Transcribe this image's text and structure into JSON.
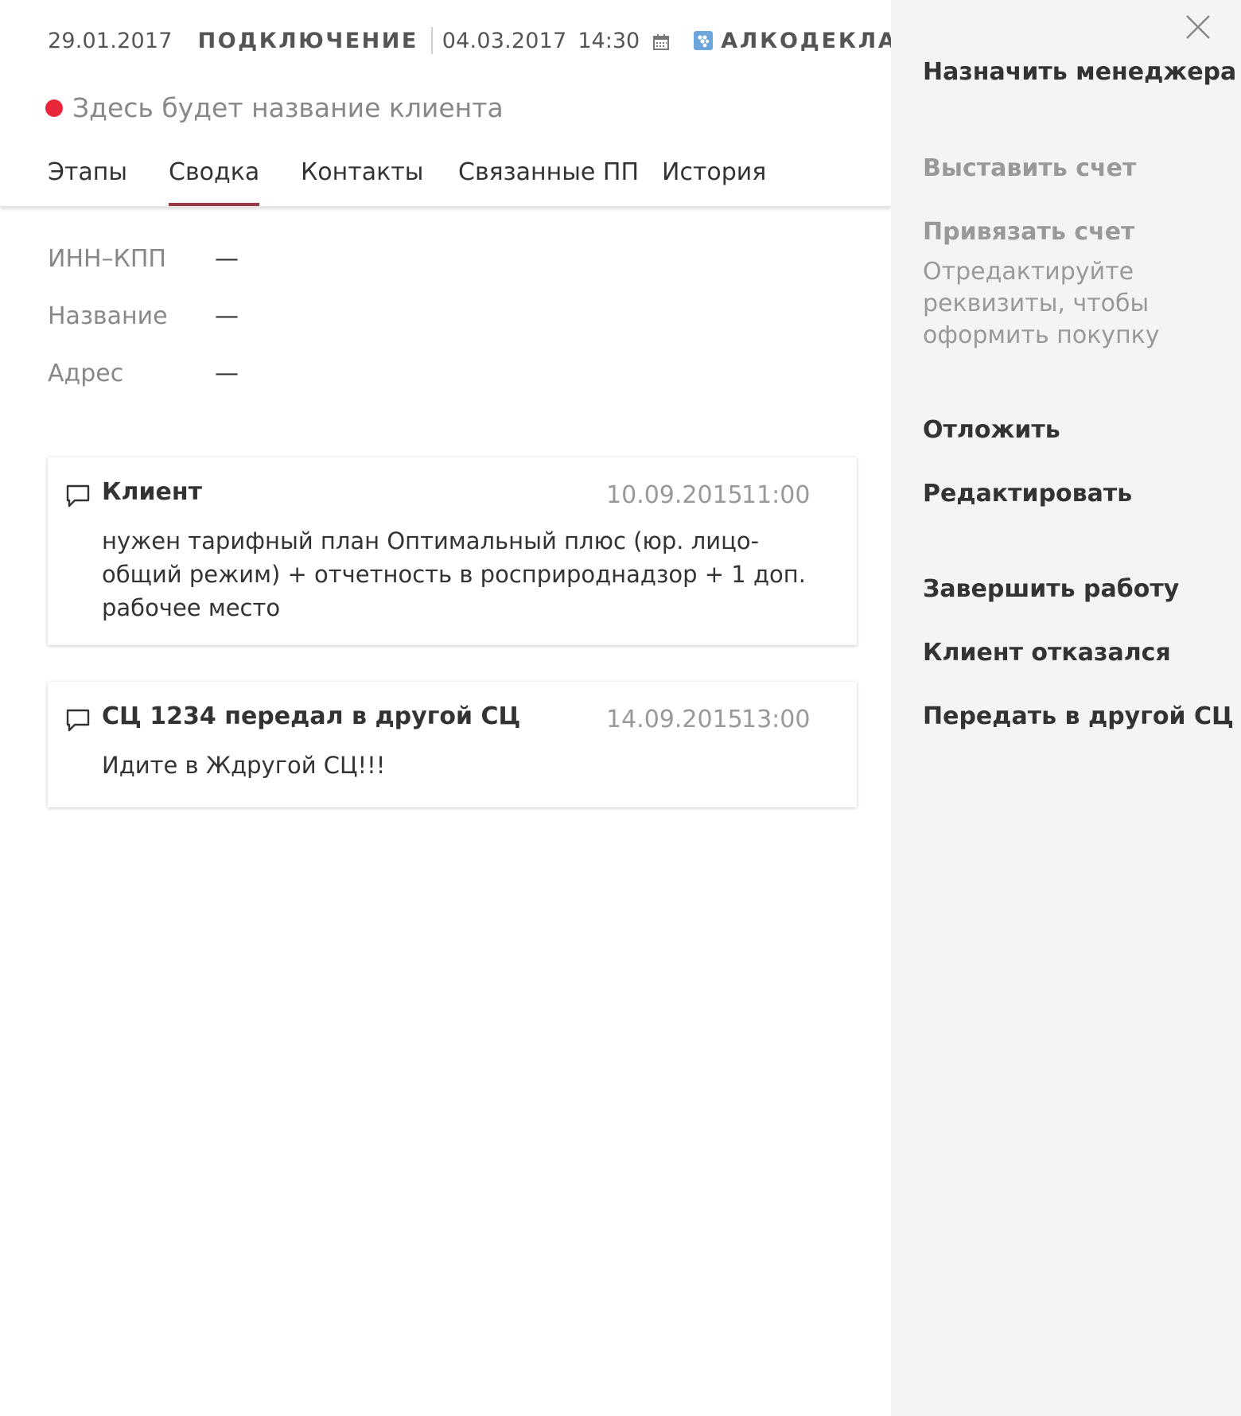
{
  "header": {
    "created_date": "29.01.2017",
    "stage": "ПОДКЛЮЧЕНИЕ",
    "deadline_date": "04.03.2017",
    "deadline_time": "14:30",
    "product": "АЛКОДЕКЛАРАЦИЯ",
    "status_color": "#e8283a",
    "client_name": "Здесь будет название клиента"
  },
  "tabs": [
    {
      "label": "Этапы",
      "active": false
    },
    {
      "label": "Сводка",
      "active": true
    },
    {
      "label": "Контакты",
      "active": false
    },
    {
      "label": "Связанные ПП",
      "active": false
    },
    {
      "label": "История",
      "active": false
    }
  ],
  "fields": [
    {
      "label": "ИНН–КПП",
      "value": "—"
    },
    {
      "label": "Название",
      "value": "—"
    },
    {
      "label": "Адрес",
      "value": "—"
    }
  ],
  "comments": [
    {
      "author": "Клиент",
      "date": "10.09.2015",
      "time": "11:00",
      "text": "нужен тарифный план Оптимальный плюс (юр. лицо-общий режим) + отчетность в росприроднадзор + 1 доп. рабочее место"
    },
    {
      "author": "СЦ 1234 передал в другой СЦ",
      "date": "14.09.2015",
      "time": "13:00",
      "text": "Идите в Ждругой СЦ!!!"
    }
  ],
  "panel": {
    "assign_manager": "Назначить менеджера",
    "issue_invoice": "Выставить счет",
    "attach_invoice": "Привязать счет",
    "attach_hint": "Отредактируйте реквизиты, чтобы оформить покупку",
    "postpone": "Отложить",
    "edit": "Редактировать",
    "finish": "Завершить работу",
    "client_refused": "Клиент отказался",
    "transfer": "Передать в другой СЦ"
  },
  "colors": {
    "accent": "#9a3a46",
    "status": "#e8283a",
    "product_icon": "#6aa6dc",
    "panel_bg": "#f4f4f4"
  },
  "icons": {
    "calendar": "calendar-icon",
    "product": "grapes-icon",
    "comment": "speech-bubble-icon",
    "close": "close-icon"
  }
}
